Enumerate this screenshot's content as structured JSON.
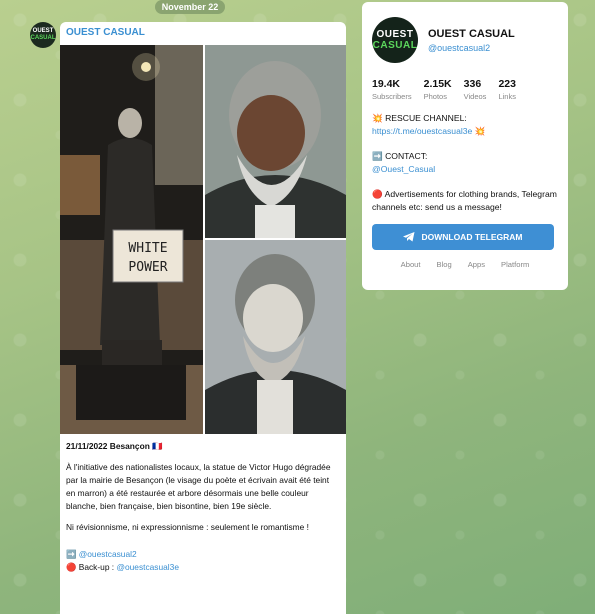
{
  "date_pill": "November 22",
  "channel": {
    "avatar_line1": "OUEST",
    "avatar_line2": "CASUAL",
    "name": "OUEST CASUAL",
    "handle": "@ouestcasual2"
  },
  "post": {
    "author": "OUEST CASUAL",
    "sign_line1": "WHITE",
    "sign_line2": "POWER",
    "date_line": "21/11/2022 Besançon 🇫🇷",
    "paragraph1": "À l'initiative des nationalistes locaux, la statue de Victor Hugo dégradée par la mairie de Besançon (le visage du poète et écrivain avait été teint en marron) a été restaurée et arbore désormais une belle couleur blanche, bien française, bien bisontine, bien 19e siècle.",
    "paragraph2": "Ni révisionnisme, ni expressionnisme : seulement le romantisme !",
    "link1_prefix": "➡️ ",
    "link1": "@ouestcasual2",
    "link2_prefix": "🔴 Back-up : ",
    "link2": "@ouestcasual3e"
  },
  "stats": [
    {
      "num": "19.4K",
      "label": "Subscribers"
    },
    {
      "num": "2.15K",
      "label": "Photos"
    },
    {
      "num": "336",
      "label": "Videos"
    },
    {
      "num": "223",
      "label": "Links"
    }
  ],
  "description": {
    "rescue_prefix": "💥 RESCUE CHANNEL: ",
    "rescue_link": "https://t.me/ouestcasual3e",
    "rescue_suffix": " 💥",
    "contact_label": "➡️ CONTACT:",
    "contact_link": "@Ouest_Casual",
    "ads": "🔴 Advertisements for clothing brands, Telegram channels etc: send us a message!"
  },
  "download_button": "DOWNLOAD TELEGRAM",
  "footer_links": [
    "About",
    "Blog",
    "Apps",
    "Platform"
  ],
  "colors": {
    "accent": "#3e8fd4",
    "link": "#3a8fd1",
    "avatar_green": "#5cd65c"
  }
}
